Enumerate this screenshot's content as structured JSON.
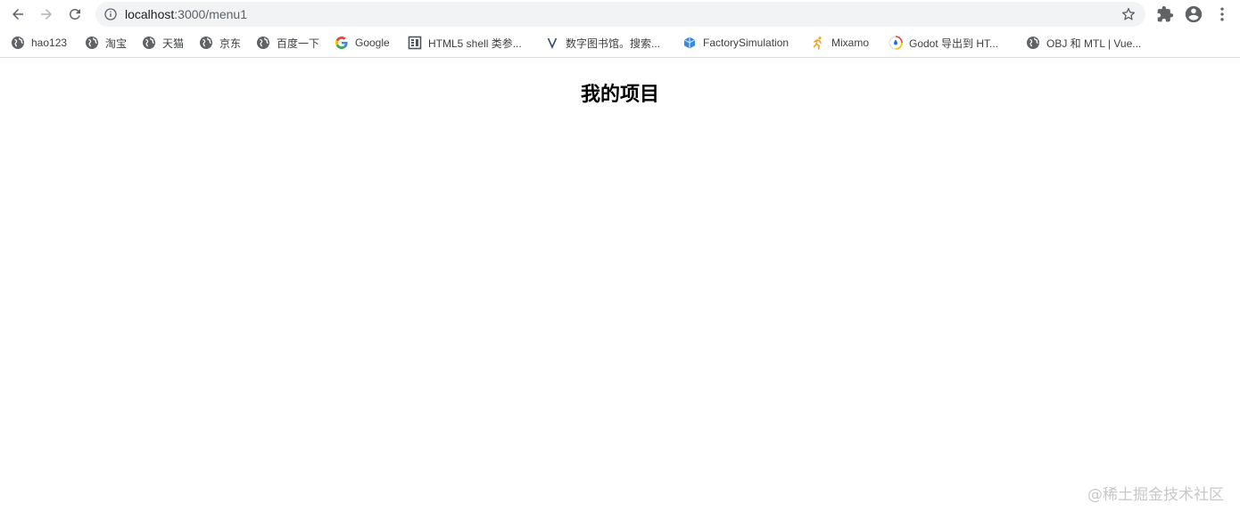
{
  "browser": {
    "url_host": "localhost",
    "url_path": ":3000/menu1",
    "colors": {
      "toolbar_bg": "#ffffff",
      "omnibox_bg": "#f1f3f4",
      "icon": "#5f6368",
      "divider": "#dadce0"
    }
  },
  "bookmarks": [
    {
      "label": "hao123",
      "icon": "globe-icon"
    },
    {
      "label": "淘宝",
      "icon": "globe-icon"
    },
    {
      "label": "天猫",
      "icon": "globe-icon"
    },
    {
      "label": "京东",
      "icon": "globe-icon"
    },
    {
      "label": "百度一下",
      "icon": "globe-icon"
    },
    {
      "label": "Google",
      "icon": "google-icon"
    },
    {
      "label": "HTML5 shell 类参...",
      "icon": "doc-icon"
    },
    {
      "label": "数字图书馆。搜索...",
      "icon": "v-icon"
    },
    {
      "label": "FactorySimulation",
      "icon": "cube-icon"
    },
    {
      "label": "Mixamo",
      "icon": "runner-icon"
    },
    {
      "label": "Godot 导出到 HT...",
      "icon": "godot-icon"
    },
    {
      "label": "OBJ 和 MTL | Vue...",
      "icon": "globe-icon"
    }
  ],
  "page": {
    "title": "我的项目"
  },
  "watermark": "@稀土掘金技术社区"
}
